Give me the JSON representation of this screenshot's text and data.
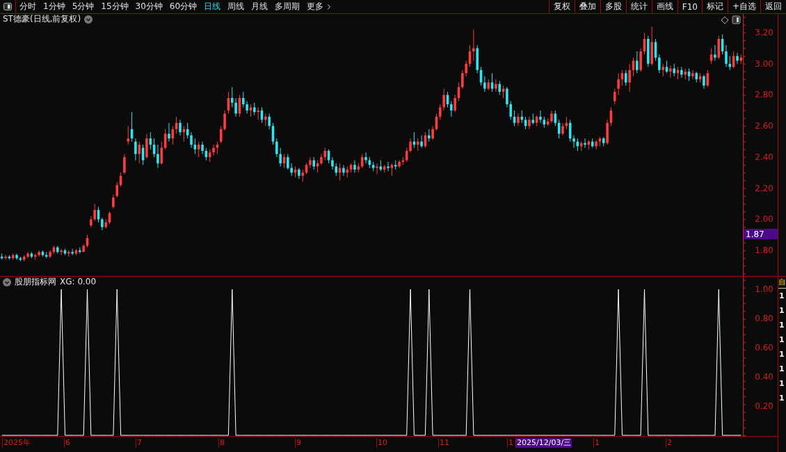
{
  "toolbar": {
    "periods": [
      {
        "label": "分时",
        "selected": false
      },
      {
        "label": "1分钟",
        "selected": false
      },
      {
        "label": "5分钟",
        "selected": false
      },
      {
        "label": "15分钟",
        "selected": false
      },
      {
        "label": "30分钟",
        "selected": false
      },
      {
        "label": "60分钟",
        "selected": false
      },
      {
        "label": "日线",
        "selected": true
      },
      {
        "label": "周线",
        "selected": false
      },
      {
        "label": "月线",
        "selected": false
      },
      {
        "label": "多周期",
        "selected": false
      }
    ],
    "more": "更多",
    "actions": [
      "复权",
      "叠加",
      "多股",
      "统计",
      "画线",
      "F10",
      "标记",
      "+自选",
      "返回"
    ]
  },
  "price_pane": {
    "title": "ST德豪(日线,前复权)",
    "current_price": "1.87",
    "chart_data": {
      "type": "candlestick",
      "categories": [
        null,
        null,
        null,
        null,
        null,
        null,
        null,
        null,
        null,
        null,
        null,
        null,
        null,
        null,
        null,
        null,
        null,
        null,
        null,
        null,
        null,
        null,
        null,
        null,
        null,
        null,
        null,
        null,
        null,
        null,
        null,
        null,
        null,
        null,
        null,
        null,
        null,
        null,
        null,
        null,
        null,
        null,
        null,
        null,
        null,
        null,
        null,
        null,
        null,
        null,
        null,
        null,
        null,
        null,
        null,
        null,
        null,
        null,
        null,
        null,
        null,
        null,
        null,
        null,
        null,
        null,
        null,
        null,
        null,
        null,
        null,
        null,
        null,
        null,
        null,
        null,
        null,
        null,
        null,
        null,
        null,
        null,
        null,
        null,
        null,
        null,
        null,
        null,
        null,
        null,
        null,
        null,
        null,
        null,
        null,
        null,
        null,
        null,
        null,
        null,
        null,
        null,
        null,
        null,
        null,
        null,
        null,
        null,
        null,
        null,
        null,
        null,
        null,
        null,
        null,
        null,
        null,
        null,
        null,
        null,
        null,
        null,
        null,
        null,
        null,
        null,
        null,
        null,
        null,
        null,
        null,
        null,
        null,
        null,
        null,
        null,
        null,
        null,
        null,
        null,
        null,
        null,
        null,
        null,
        null,
        null,
        null,
        null,
        null,
        null,
        null,
        null,
        null,
        null,
        null,
        null,
        null,
        null,
        null,
        null,
        null,
        null,
        null,
        null,
        null,
        null,
        null,
        null,
        null,
        null,
        null,
        null,
        null,
        null,
        null,
        null,
        null,
        null,
        null,
        null,
        null,
        null,
        null,
        null,
        null,
        null,
        null,
        null,
        null,
        null,
        null,
        null,
        null,
        null,
        null,
        null,
        null,
        null,
        null,
        null
      ],
      "ohlc": [
        [
          1.76,
          1.78,
          1.74,
          1.75
        ],
        [
          1.75,
          1.77,
          1.74,
          1.76
        ],
        [
          1.76,
          1.77,
          1.74,
          1.75
        ],
        [
          1.75,
          1.78,
          1.74,
          1.77
        ],
        [
          1.77,
          1.78,
          1.74,
          1.75
        ],
        [
          1.75,
          1.76,
          1.73,
          1.74
        ],
        [
          1.74,
          1.77,
          1.73,
          1.76
        ],
        [
          1.76,
          1.79,
          1.75,
          1.78
        ],
        [
          1.78,
          1.79,
          1.75,
          1.76
        ],
        [
          1.76,
          1.78,
          1.74,
          1.77
        ],
        [
          1.77,
          1.8,
          1.76,
          1.79
        ],
        [
          1.79,
          1.8,
          1.76,
          1.77
        ],
        [
          1.77,
          1.79,
          1.75,
          1.76
        ],
        [
          1.76,
          1.8,
          1.75,
          1.79
        ],
        [
          1.79,
          1.83,
          1.78,
          1.82
        ],
        [
          1.82,
          1.83,
          1.78,
          1.79
        ],
        [
          1.79,
          1.81,
          1.77,
          1.8
        ],
        [
          1.8,
          1.81,
          1.77,
          1.78
        ],
        [
          1.78,
          1.8,
          1.76,
          1.79
        ],
        [
          1.79,
          1.81,
          1.77,
          1.78
        ],
        [
          1.78,
          1.81,
          1.77,
          1.8
        ],
        [
          1.8,
          1.82,
          1.78,
          1.79
        ],
        [
          1.79,
          1.84,
          1.79,
          1.83
        ],
        [
          1.83,
          1.9,
          1.82,
          1.88
        ],
        [
          1.96,
          2.02,
          1.95,
          2.0
        ],
        [
          2.0,
          2.1,
          1.99,
          2.06
        ],
        [
          2.06,
          2.08,
          1.98,
          2.0
        ],
        [
          2.0,
          2.01,
          1.93,
          1.95
        ],
        [
          1.95,
          2.0,
          1.94,
          1.98
        ],
        [
          1.98,
          2.05,
          1.97,
          2.04
        ],
        [
          2.08,
          2.16,
          2.07,
          2.14
        ],
        [
          2.15,
          2.24,
          2.14,
          2.22
        ],
        [
          2.22,
          2.3,
          2.21,
          2.28
        ],
        [
          2.3,
          2.42,
          2.29,
          2.4
        ],
        [
          2.5,
          2.6,
          2.48,
          2.52
        ],
        [
          2.58,
          2.69,
          2.5,
          2.52
        ],
        [
          2.5,
          2.52,
          2.38,
          2.42
        ],
        [
          2.42,
          2.5,
          2.36,
          2.48
        ],
        [
          2.46,
          2.48,
          2.35,
          2.38
        ],
        [
          2.4,
          2.55,
          2.39,
          2.52
        ],
        [
          2.52,
          2.56,
          2.45,
          2.48
        ],
        [
          2.48,
          2.52,
          2.4,
          2.42
        ],
        [
          2.42,
          2.48,
          2.33,
          2.36
        ],
        [
          2.36,
          2.5,
          2.35,
          2.46
        ],
        [
          2.46,
          2.58,
          2.45,
          2.55
        ],
        [
          2.55,
          2.62,
          2.5,
          2.52
        ],
        [
          2.52,
          2.6,
          2.48,
          2.58
        ],
        [
          2.58,
          2.66,
          2.55,
          2.62
        ],
        [
          2.62,
          2.64,
          2.54,
          2.56
        ],
        [
          2.56,
          2.6,
          2.5,
          2.58
        ],
        [
          2.58,
          2.62,
          2.52,
          2.54
        ],
        [
          2.54,
          2.56,
          2.46,
          2.48
        ],
        [
          2.48,
          2.52,
          2.42,
          2.45
        ],
        [
          2.45,
          2.5,
          2.4,
          2.48
        ],
        [
          2.48,
          2.5,
          2.42,
          2.44
        ],
        [
          2.44,
          2.46,
          2.38,
          2.4
        ],
        [
          2.4,
          2.45,
          2.37,
          2.43
        ],
        [
          2.43,
          2.48,
          2.41,
          2.46
        ],
        [
          2.46,
          2.5,
          2.42,
          2.48
        ],
        [
          2.5,
          2.6,
          2.49,
          2.58
        ],
        [
          2.58,
          2.7,
          2.57,
          2.68
        ],
        [
          2.7,
          2.82,
          2.68,
          2.78
        ],
        [
          2.78,
          2.85,
          2.72,
          2.75
        ],
        [
          2.75,
          2.78,
          2.66,
          2.68
        ],
        [
          2.68,
          2.8,
          2.66,
          2.78
        ],
        [
          2.78,
          2.82,
          2.72,
          2.74
        ],
        [
          2.74,
          2.76,
          2.68,
          2.7
        ],
        [
          2.7,
          2.74,
          2.66,
          2.72
        ],
        [
          2.72,
          2.75,
          2.67,
          2.69
        ],
        [
          2.69,
          2.72,
          2.64,
          2.7
        ],
        [
          2.7,
          2.72,
          2.62,
          2.64
        ],
        [
          2.64,
          2.68,
          2.6,
          2.66
        ],
        [
          2.66,
          2.68,
          2.58,
          2.6
        ],
        [
          2.6,
          2.62,
          2.48,
          2.5
        ],
        [
          2.5,
          2.52,
          2.4,
          2.42
        ],
        [
          2.42,
          2.46,
          2.34,
          2.36
        ],
        [
          2.36,
          2.42,
          2.33,
          2.4
        ],
        [
          2.4,
          2.42,
          2.32,
          2.33
        ],
        [
          2.33,
          2.36,
          2.28,
          2.3
        ],
        [
          2.3,
          2.34,
          2.27,
          2.32
        ],
        [
          2.32,
          2.33,
          2.26,
          2.28
        ],
        [
          2.28,
          2.32,
          2.24,
          2.3
        ],
        [
          2.3,
          2.36,
          2.29,
          2.35
        ],
        [
          2.35,
          2.4,
          2.33,
          2.38
        ],
        [
          2.38,
          2.4,
          2.32,
          2.34
        ],
        [
          2.34,
          2.38,
          2.3,
          2.36
        ],
        [
          2.36,
          2.42,
          2.35,
          2.4
        ],
        [
          2.4,
          2.46,
          2.38,
          2.44
        ],
        [
          2.44,
          2.45,
          2.36,
          2.38
        ],
        [
          2.38,
          2.4,
          2.32,
          2.34
        ],
        [
          2.34,
          2.36,
          2.28,
          2.3
        ],
        [
          2.3,
          2.36,
          2.25,
          2.33
        ],
        [
          2.33,
          2.35,
          2.28,
          2.3
        ],
        [
          2.3,
          2.34,
          2.27,
          2.32
        ],
        [
          2.32,
          2.36,
          2.3,
          2.35
        ],
        [
          2.35,
          2.38,
          2.3,
          2.32
        ],
        [
          2.32,
          2.36,
          2.3,
          2.34
        ],
        [
          2.34,
          2.42,
          2.33,
          2.4
        ],
        [
          2.4,
          2.43,
          2.36,
          2.38
        ],
        [
          2.38,
          2.4,
          2.33,
          2.35
        ],
        [
          2.35,
          2.37,
          2.31,
          2.33
        ],
        [
          2.33,
          2.36,
          2.29,
          2.34
        ],
        [
          2.34,
          2.38,
          2.31,
          2.32
        ],
        [
          2.32,
          2.35,
          2.3,
          2.34
        ],
        [
          2.34,
          2.37,
          2.31,
          2.33
        ],
        [
          2.33,
          2.36,
          2.28,
          2.35
        ],
        [
          2.35,
          2.38,
          2.32,
          2.34
        ],
        [
          2.34,
          2.38,
          2.33,
          2.37
        ],
        [
          2.37,
          2.4,
          2.35,
          2.38
        ],
        [
          2.38,
          2.46,
          2.37,
          2.44
        ],
        [
          2.44,
          2.52,
          2.43,
          2.5
        ],
        [
          2.5,
          2.56,
          2.46,
          2.48
        ],
        [
          2.48,
          2.52,
          2.44,
          2.5
        ],
        [
          2.5,
          2.54,
          2.46,
          2.47
        ],
        [
          2.47,
          2.56,
          2.46,
          2.54
        ],
        [
          2.54,
          2.58,
          2.5,
          2.52
        ],
        [
          2.52,
          2.6,
          2.51,
          2.58
        ],
        [
          2.58,
          2.68,
          2.57,
          2.66
        ],
        [
          2.66,
          2.74,
          2.64,
          2.72
        ],
        [
          2.72,
          2.84,
          2.7,
          2.8
        ],
        [
          2.8,
          2.82,
          2.72,
          2.74
        ],
        [
          2.74,
          2.76,
          2.66,
          2.7
        ],
        [
          2.7,
          2.8,
          2.69,
          2.78
        ],
        [
          2.78,
          2.88,
          2.76,
          2.85
        ],
        [
          2.85,
          2.96,
          2.84,
          2.94
        ],
        [
          2.94,
          3.02,
          2.92,
          3.0
        ],
        [
          3.0,
          3.12,
          2.98,
          3.08
        ],
        [
          3.08,
          3.22,
          3.02,
          3.1
        ],
        [
          3.1,
          3.12,
          2.94,
          2.96
        ],
        [
          2.96,
          2.98,
          2.86,
          2.88
        ],
        [
          2.88,
          2.92,
          2.82,
          2.84
        ],
        [
          2.84,
          2.9,
          2.83,
          2.88
        ],
        [
          2.88,
          2.94,
          2.82,
          2.84
        ],
        [
          2.84,
          2.9,
          2.82,
          2.87
        ],
        [
          2.87,
          2.89,
          2.8,
          2.82
        ],
        [
          2.82,
          2.86,
          2.78,
          2.84
        ],
        [
          2.84,
          2.85,
          2.72,
          2.74
        ],
        [
          2.74,
          2.76,
          2.64,
          2.66
        ],
        [
          2.66,
          2.7,
          2.6,
          2.62
        ],
        [
          2.62,
          2.68,
          2.6,
          2.66
        ],
        [
          2.66,
          2.7,
          2.62,
          2.64
        ],
        [
          2.64,
          2.66,
          2.58,
          2.6
        ],
        [
          2.6,
          2.66,
          2.58,
          2.64
        ],
        [
          2.64,
          2.68,
          2.61,
          2.62
        ],
        [
          2.62,
          2.67,
          2.6,
          2.66
        ],
        [
          2.66,
          2.7,
          2.62,
          2.64
        ],
        [
          2.64,
          2.66,
          2.59,
          2.61
        ],
        [
          2.61,
          2.65,
          2.6,
          2.63
        ],
        [
          2.63,
          2.7,
          2.62,
          2.68
        ],
        [
          2.68,
          2.7,
          2.6,
          2.62
        ],
        [
          2.62,
          2.64,
          2.52,
          2.55
        ],
        [
          2.55,
          2.62,
          2.54,
          2.6
        ],
        [
          2.6,
          2.66,
          2.58,
          2.62
        ],
        [
          2.62,
          2.64,
          2.5,
          2.52
        ],
        [
          2.52,
          2.54,
          2.46,
          2.5
        ],
        [
          2.5,
          2.52,
          2.44,
          2.47
        ],
        [
          2.47,
          2.5,
          2.44,
          2.49
        ],
        [
          2.49,
          2.52,
          2.46,
          2.48
        ],
        [
          2.48,
          2.51,
          2.45,
          2.5
        ],
        [
          2.5,
          2.52,
          2.46,
          2.47
        ],
        [
          2.47,
          2.51,
          2.45,
          2.5
        ],
        [
          2.5,
          2.53,
          2.47,
          2.52
        ],
        [
          2.52,
          2.53,
          2.47,
          2.49
        ],
        [
          2.49,
          2.64,
          2.48,
          2.62
        ],
        [
          2.62,
          2.72,
          2.6,
          2.7
        ],
        [
          2.76,
          2.84,
          2.74,
          2.82
        ],
        [
          2.84,
          2.94,
          2.8,
          2.9
        ],
        [
          2.9,
          2.96,
          2.86,
          2.94
        ],
        [
          2.94,
          2.96,
          2.86,
          2.88
        ],
        [
          2.88,
          3.0,
          2.82,
          2.96
        ],
        [
          2.96,
          3.04,
          2.92,
          3.02
        ],
        [
          3.02,
          3.08,
          2.94,
          2.96
        ],
        [
          2.96,
          3.1,
          2.95,
          3.08
        ],
        [
          3.08,
          3.2,
          3.06,
          3.16
        ],
        [
          3.16,
          3.18,
          2.98,
          3.0
        ],
        [
          3.0,
          3.24,
          2.99,
          3.14
        ],
        [
          3.14,
          3.16,
          3.02,
          3.04
        ],
        [
          3.04,
          3.06,
          2.94,
          2.96
        ],
        [
          2.96,
          3.0,
          2.92,
          2.98
        ],
        [
          2.98,
          3.02,
          2.94,
          2.95
        ],
        [
          2.95,
          2.99,
          2.91,
          2.97
        ],
        [
          2.97,
          3.0,
          2.92,
          2.94
        ],
        [
          2.94,
          2.98,
          2.9,
          2.96
        ],
        [
          2.96,
          2.98,
          2.91,
          2.93
        ],
        [
          2.93,
          2.97,
          2.9,
          2.95
        ],
        [
          2.95,
          2.97,
          2.89,
          2.92
        ],
        [
          2.92,
          2.96,
          2.9,
          2.94
        ],
        [
          2.94,
          2.95,
          2.88,
          2.9
        ],
        [
          2.9,
          2.94,
          2.88,
          2.92
        ],
        [
          2.92,
          2.93,
          2.84,
          2.86
        ],
        [
          2.86,
          2.96,
          2.85,
          2.94
        ],
        [
          3.02,
          3.1,
          3.0,
          3.06
        ],
        [
          3.06,
          3.12,
          3.02,
          3.04
        ],
        [
          3.04,
          3.18,
          3.03,
          3.16
        ],
        [
          3.16,
          3.19,
          3.06,
          3.08
        ],
        [
          3.08,
          3.12,
          2.98,
          3.0
        ],
        [
          3.0,
          3.05,
          2.96,
          2.98
        ],
        [
          2.98,
          3.08,
          2.97,
          3.05
        ],
        [
          3.05,
          3.07,
          3.0,
          3.02
        ],
        [
          3.02,
          3.06,
          3.0,
          3.04
        ]
      ],
      "ylim": [
        1.635,
        3.321
      ],
      "grid": true,
      "yticks": [
        {
          "value": 3.2,
          "label": "3.20"
        },
        {
          "value": 3,
          "label": "3.00"
        },
        {
          "value": 2.8,
          "label": "2.80"
        },
        {
          "value": 2.6,
          "label": "2.60"
        },
        {
          "value": 2.4,
          "label": "2.40"
        },
        {
          "value": 2.2,
          "label": "2.20"
        },
        {
          "value": 2,
          "label": "2.00"
        },
        {
          "value": 1.8,
          "label": "1.80"
        }
      ]
    }
  },
  "indicator_pane": {
    "name": "股朋指标网",
    "reading": "XG: 0.00",
    "chart_data": {
      "type": "line",
      "categories": [
        null,
        null,
        null,
        null,
        null,
        null,
        null,
        null,
        null,
        null,
        null,
        null,
        null,
        null,
        null,
        null,
        null,
        null,
        null,
        null,
        null,
        null,
        null,
        null,
        null,
        null,
        null,
        null,
        null,
        null,
        null,
        null,
        null,
        null,
        null,
        null,
        null,
        null,
        null,
        null,
        null,
        null,
        null,
        null,
        null,
        null,
        null,
        null,
        null,
        null,
        null,
        null,
        null,
        null,
        null,
        null,
        null,
        null,
        null,
        null,
        null,
        null,
        null,
        null,
        null,
        null,
        null,
        null,
        null,
        null,
        null,
        null,
        null,
        null,
        null,
        null,
        null,
        null,
        null,
        null,
        null,
        null,
        null,
        null,
        null,
        null,
        null,
        null,
        null,
        null,
        null,
        null,
        null,
        null,
        null,
        null,
        null,
        null,
        null,
        null,
        null,
        null,
        null,
        null,
        null,
        null,
        null,
        null,
        null,
        null,
        null,
        null,
        null,
        null,
        null,
        null,
        null,
        null,
        null,
        null,
        null,
        null,
        null,
        null,
        null,
        null,
        null,
        null,
        null,
        null,
        null,
        null,
        null,
        null,
        null,
        null,
        null,
        null,
        null,
        null,
        null,
        null,
        null,
        null,
        null,
        null,
        null,
        null,
        null,
        null,
        null,
        null,
        null,
        null,
        null,
        null,
        null,
        null,
        null,
        null,
        null,
        null,
        null,
        null,
        null,
        null,
        null,
        null,
        null,
        null,
        null,
        null,
        null,
        null,
        null,
        null,
        null,
        null,
        null,
        null,
        null,
        null,
        null,
        null,
        null,
        null,
        null,
        null,
        null,
        null,
        null,
        null,
        null,
        null,
        null,
        null,
        null,
        null,
        null,
        null
      ],
      "values": [
        0,
        0,
        0,
        0,
        0,
        0,
        0,
        0,
        0,
        0,
        0,
        0,
        0,
        0,
        0,
        0,
        1,
        0,
        0,
        0,
        0,
        0,
        0,
        1,
        0,
        0,
        0,
        0,
        0,
        0,
        0,
        1,
        0,
        0,
        0,
        0,
        0,
        0,
        0,
        0,
        0,
        0,
        0,
        0,
        0,
        0,
        0,
        0,
        0,
        0,
        0,
        0,
        0,
        0,
        0,
        0,
        0,
        0,
        0,
        0,
        0,
        0,
        1,
        0,
        0,
        0,
        0,
        0,
        0,
        0,
        0,
        0,
        0,
        0,
        0,
        0,
        0,
        0,
        0,
        0,
        0,
        0,
        0,
        0,
        0,
        0,
        0,
        0,
        0,
        0,
        0,
        0,
        0,
        0,
        0,
        0,
        0,
        0,
        0,
        0,
        0,
        0,
        0,
        0,
        0,
        0,
        0,
        0,
        0,
        0,
        1,
        0,
        0,
        0,
        0,
        1,
        0,
        0,
        0,
        0,
        0,
        0,
        0,
        0,
        0,
        0,
        1,
        0,
        0,
        0,
        0,
        0,
        0,
        0,
        0,
        0,
        0,
        0,
        0,
        0,
        0,
        0,
        0,
        0,
        0,
        0,
        0,
        0,
        0,
        0,
        0,
        0,
        0,
        0,
        0,
        0,
        0,
        0,
        0,
        0,
        0,
        0,
        0,
        0,
        0,
        0,
        1,
        0,
        0,
        0,
        0,
        0,
        0,
        1,
        0,
        0,
        0,
        0,
        0,
        0,
        0,
        0,
        0,
        0,
        0,
        0,
        0,
        0,
        0,
        0,
        0,
        0,
        0,
        1,
        0,
        0,
        0,
        0,
        0,
        0
      ],
      "ylim": [
        0,
        1.086
      ],
      "grid": true,
      "yticks": [
        {
          "value": 0.2,
          "label": "0.20"
        },
        {
          "value": 0.4,
          "label": "0.40"
        },
        {
          "value": 0.6,
          "label": "0.60"
        },
        {
          "value": 0.8,
          "label": "0.80"
        },
        {
          "value": 1,
          "label": "1.00"
        }
      ]
    }
  },
  "side_strip": {
    "header": "自",
    "values": [
      "1",
      "1",
      "1",
      "1",
      "1",
      "1",
      "1",
      "1"
    ]
  },
  "date_axis": [
    {
      "label": "2025年",
      "kind": "year"
    },
    {
      "label": "6",
      "kind": "month"
    },
    {
      "label": "7",
      "kind": "month"
    },
    {
      "label": "8",
      "kind": "month"
    },
    {
      "label": "9",
      "kind": "month"
    },
    {
      "label": "10",
      "kind": "month"
    },
    {
      "label": "11",
      "kind": "month"
    },
    {
      "label": "1",
      "kind": "month"
    },
    {
      "label": "2025/12/03/三",
      "kind": "cursor"
    },
    {
      "label": "1",
      "kind": "month"
    },
    {
      "label": "2",
      "kind": "month"
    }
  ]
}
